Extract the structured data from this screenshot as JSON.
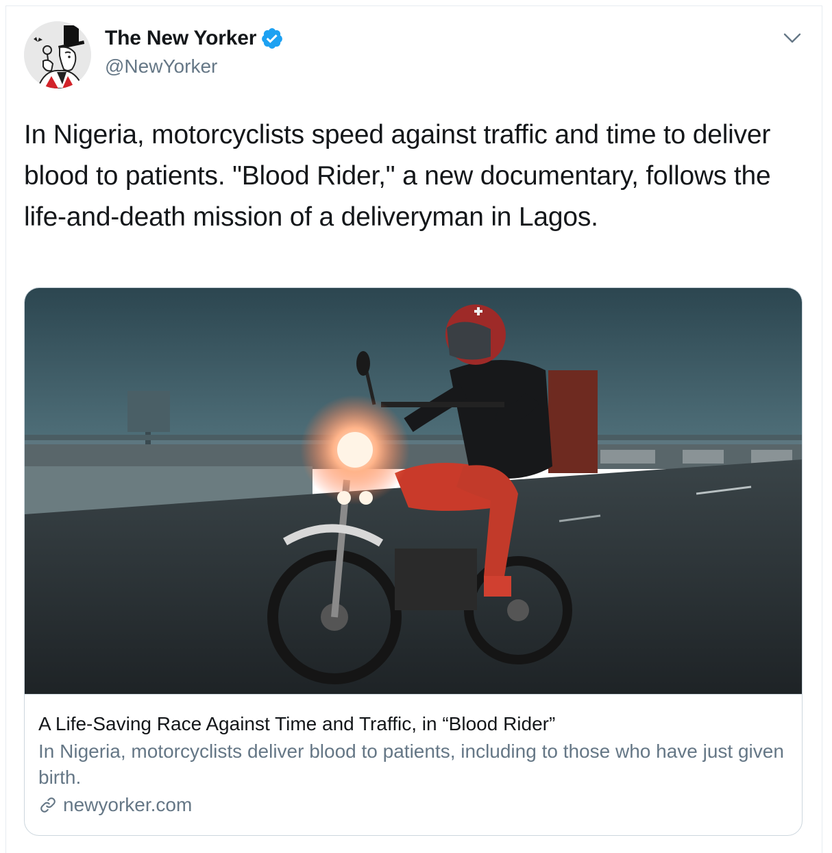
{
  "author": {
    "display_name": "The New Yorker",
    "handle": "@NewYorker",
    "verified": true
  },
  "tweet": {
    "text": "In Nigeria, motorcyclists speed against traffic and time to deliver blood to patients. \"Blood Rider,\" a new documentary, follows the life-and-death mission of a deliveryman in Lagos."
  },
  "card": {
    "title": "A Life-Saving Race Against Time and Traffic, in “Blood Rider”",
    "description": "In Nigeria, motorcyclists deliver blood to patients, including to those who have just given birth.",
    "domain": "newyorker.com"
  },
  "icons": {
    "verified": "verified-badge-icon",
    "menu": "chevron-down-icon",
    "link": "link-icon"
  },
  "colors": {
    "verified_blue": "#1da1f2",
    "secondary_text": "#657786",
    "border": "#ccd6dd"
  }
}
